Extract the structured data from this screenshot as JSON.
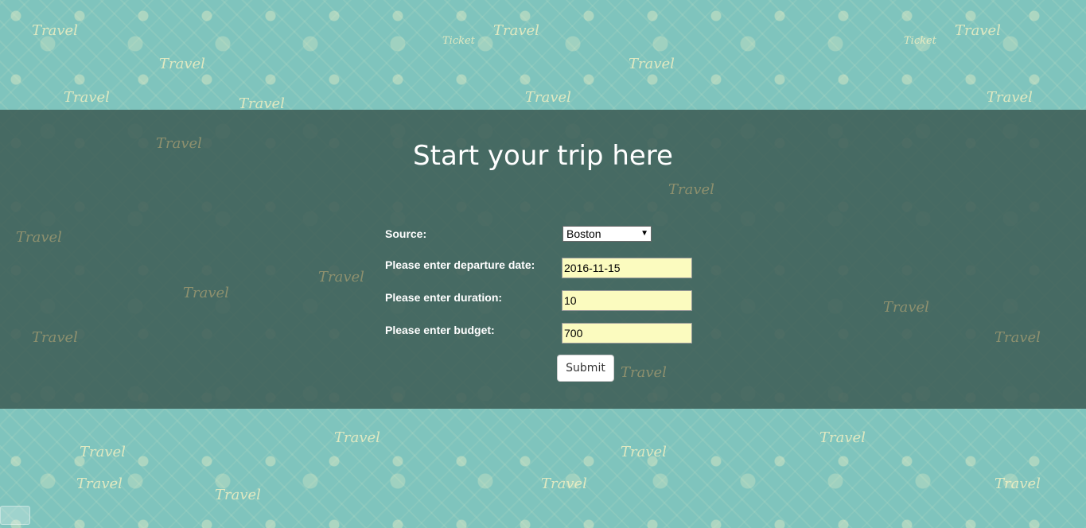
{
  "page": {
    "title": "Start your trip here"
  },
  "form": {
    "source_label": "Source:",
    "source_value": "Boston",
    "departure_label": "Please enter departure date:",
    "departure_value": "2016-11-15",
    "duration_label": "Please enter duration:",
    "duration_value": "10",
    "budget_label": "Please enter budget:",
    "budget_value": "700",
    "submit_label": "Submit"
  },
  "background": {
    "pattern_word": "Travel",
    "ticket_word": "Ticket"
  },
  "colors": {
    "background": "#7fc4bd",
    "band": "#3f5d56",
    "input_fill": "#fbfbbf"
  }
}
